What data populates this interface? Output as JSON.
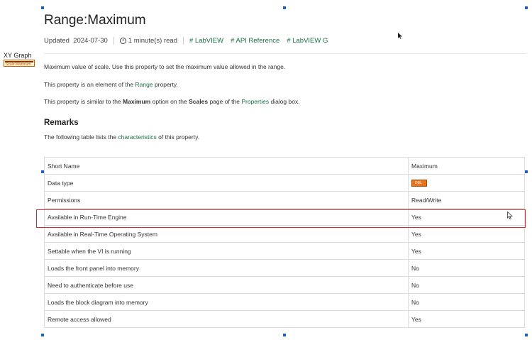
{
  "widget": {
    "label": "XY Graph",
    "node_text": "Scale.Maximum"
  },
  "page": {
    "title": "Range:Maximum",
    "meta": {
      "updated_label": "Updated",
      "updated_date": "2024-07-30",
      "read_time": "1 minute(s) read",
      "tags": [
        "LabVIEW",
        "API Reference",
        "LabVIEW G"
      ]
    },
    "paragraphs": {
      "p1": "Maximum value of scale. Use this property to set the maximum value allowed in the range.",
      "p2_before": "This property is an element of the ",
      "p2_link": "Range",
      "p2_after": " property.",
      "p3_a": "This property is similar to the ",
      "p3_b": "Maximum",
      "p3_c": " option on the ",
      "p3_d": "Scales",
      "p3_e": " page of the ",
      "p3_link": "Properties",
      "p3_f": " dialog box."
    },
    "remarks": {
      "heading": "Remarks",
      "text_before": "The following table lists the ",
      "text_link": "characteristics",
      "text_after": " of this property."
    },
    "table": {
      "rows": [
        {
          "name": "Short Name",
          "value": "Maximum"
        },
        {
          "name": "Data type",
          "value": "",
          "icon_text": "DBL"
        },
        {
          "name": "Permissions",
          "value": "Read/Write"
        },
        {
          "name": "Available in Run-Time Engine",
          "value": "Yes"
        },
        {
          "name": "Available in Real-Time Operating System",
          "value": "Yes"
        },
        {
          "name": "Settable when the VI is running",
          "value": "Yes"
        },
        {
          "name": "Loads the front panel into memory",
          "value": "No"
        },
        {
          "name": "Need to authenticate before use",
          "value": "No"
        },
        {
          "name": "Loads the block diagram into memory",
          "value": "No"
        },
        {
          "name": "Remote access allowed",
          "value": "Yes"
        }
      ],
      "highlighted_row": 3
    }
  },
  "colors": {
    "link": "#1a6e43",
    "highlight": "#d9282f",
    "handle": "#1f5fbf"
  }
}
